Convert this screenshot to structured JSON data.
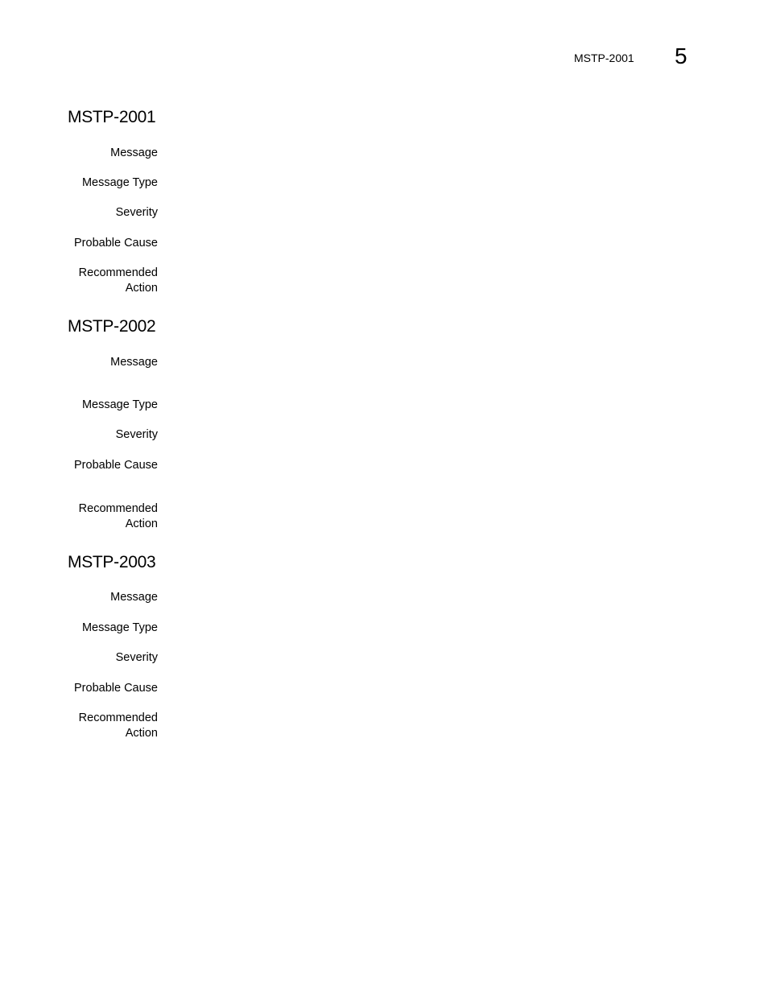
{
  "header": {
    "running_title": "MSTP-2001",
    "chapter_number": "5"
  },
  "labels": {
    "message": "Message",
    "message_type": "Message Type",
    "severity": "Severity",
    "probable_cause": "Probable Cause",
    "recommended_action_line1": "Recommended",
    "recommended_action_line2": "Action"
  },
  "sections": [
    {
      "title": "MSTP-2001"
    },
    {
      "title": "MSTP-2002"
    },
    {
      "title": "MSTP-2003"
    }
  ]
}
